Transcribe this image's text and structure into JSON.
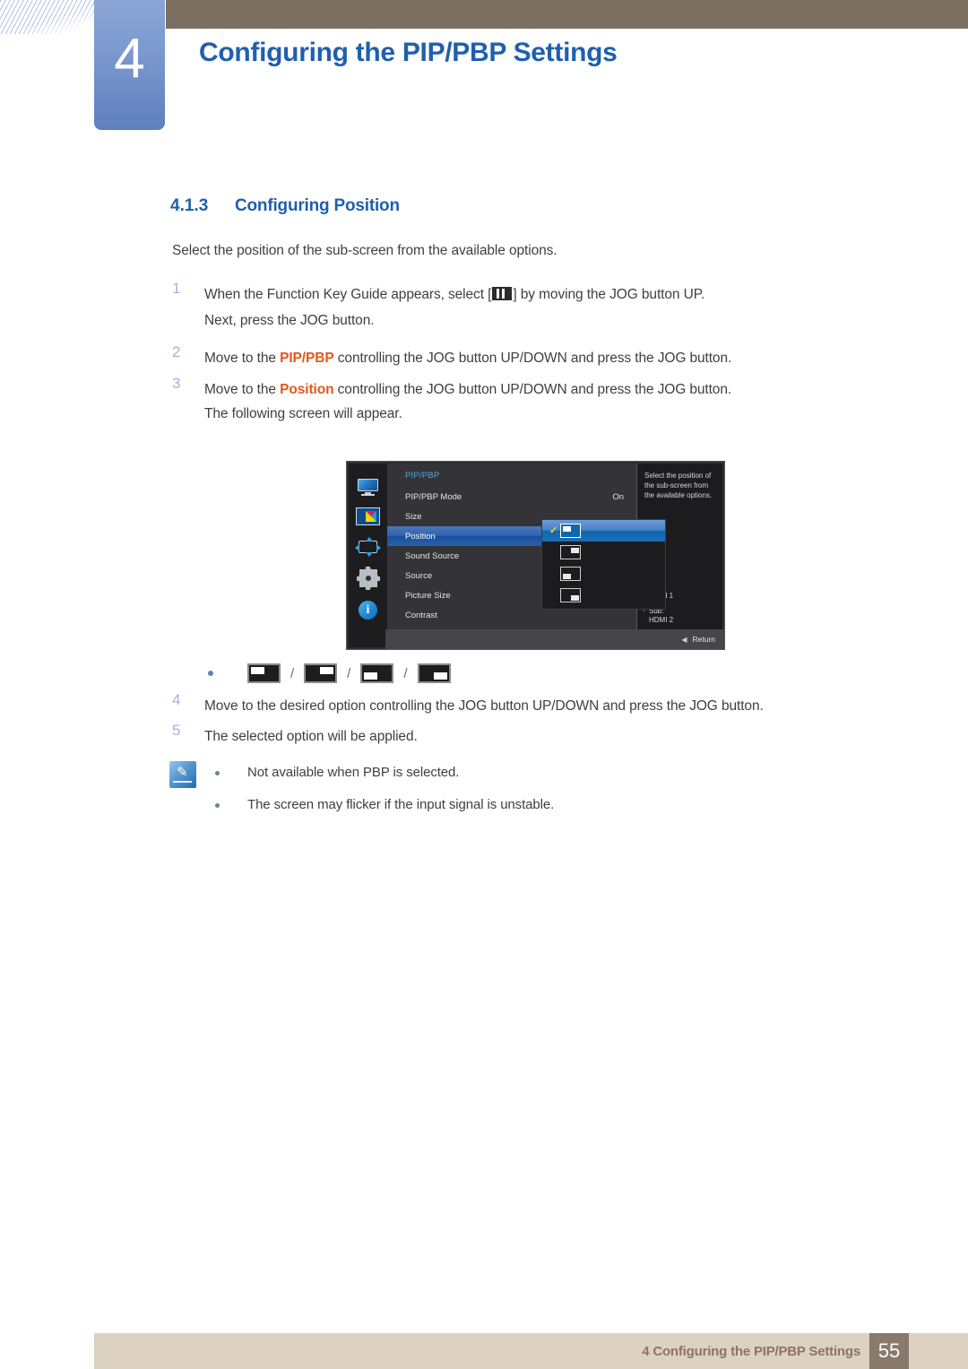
{
  "header": {
    "chapter_number": "4",
    "chapter_title": "Configuring the PIP/PBP Settings"
  },
  "section": {
    "number": "4.1.3",
    "title": "Configuring Position",
    "intro": "Select the position of the sub-screen from the available options."
  },
  "steps": [
    {
      "num": "1",
      "text_before": "When the Function Key Guide appears, select [",
      "icon": "pip-pbp-icon",
      "text_after": "] by moving the JOG button UP.",
      "continuation": "Next, press the JOG button."
    },
    {
      "num": "2",
      "text_before": "Move to the ",
      "keyword": "PIP/PBP",
      "text_after": " controlling the JOG button UP/DOWN and press the JOG button."
    },
    {
      "num": "3",
      "text_before": "Move to the ",
      "keyword": "Position",
      "text_after": " controlling the JOG button UP/DOWN and press the JOG button.",
      "continuation": "The following screen will appear."
    },
    {
      "num": "4",
      "text_before": "Move to the desired option controlling the JOG button UP/DOWN and press the JOG button."
    },
    {
      "num": "5",
      "text_before": "The selected option will be applied."
    }
  ],
  "osd": {
    "title": "PIP/PBP",
    "icons": [
      {
        "name": "monitor-icon",
        "label": "Picture"
      },
      {
        "name": "pip-pbp-icon",
        "label": "PIP/PBP"
      },
      {
        "name": "onscreen-display-icon",
        "label": "OnScreen Display"
      },
      {
        "name": "system-gear-icon",
        "label": "System"
      },
      {
        "name": "information-icon",
        "label": "Information"
      }
    ],
    "rows": [
      {
        "label": "PIP/PBP Mode",
        "value": "On",
        "selected": false
      },
      {
        "label": "Size",
        "value": "",
        "selected": false
      },
      {
        "label": "Position",
        "value": "",
        "selected": true
      },
      {
        "label": "Sound Source",
        "value": "",
        "selected": false
      },
      {
        "label": "Source",
        "value": "",
        "selected": false
      },
      {
        "label": "Picture Size",
        "value": "",
        "selected": false
      },
      {
        "label": "Contrast",
        "value": "",
        "selected": false
      }
    ],
    "dropdown_options": [
      {
        "position": "top-left",
        "checked": true
      },
      {
        "position": "top-right",
        "checked": false
      },
      {
        "position": "bottom-left",
        "checked": false
      },
      {
        "position": "bottom-right",
        "checked": false
      }
    ],
    "description": "Select the position of the sub-screen from the available options.",
    "sources": [
      {
        "label": "Main:",
        "value": "HDMI 1"
      },
      {
        "label": "Sub:",
        "value": "HDMI 2"
      }
    ],
    "return_label": "Return",
    "colors": {
      "menu_bg": "#343438",
      "panel_bg": "#1c1c1e",
      "highlight": "#1167ad",
      "title_blue": "#49a9e0",
      "check_yellow": "#f2e00c"
    }
  },
  "position_legend": {
    "separator": "/",
    "options": [
      {
        "position": "top-left"
      },
      {
        "position": "top-right"
      },
      {
        "position": "bottom-left"
      },
      {
        "position": "bottom-right"
      }
    ]
  },
  "notes": {
    "icon": "note-pen-icon",
    "items": [
      "Not available when PBP is selected.",
      "The screen may flicker if the input signal is unstable."
    ]
  },
  "footer": {
    "text": "4 Configuring the PIP/PBP Settings",
    "page_number": "55"
  }
}
